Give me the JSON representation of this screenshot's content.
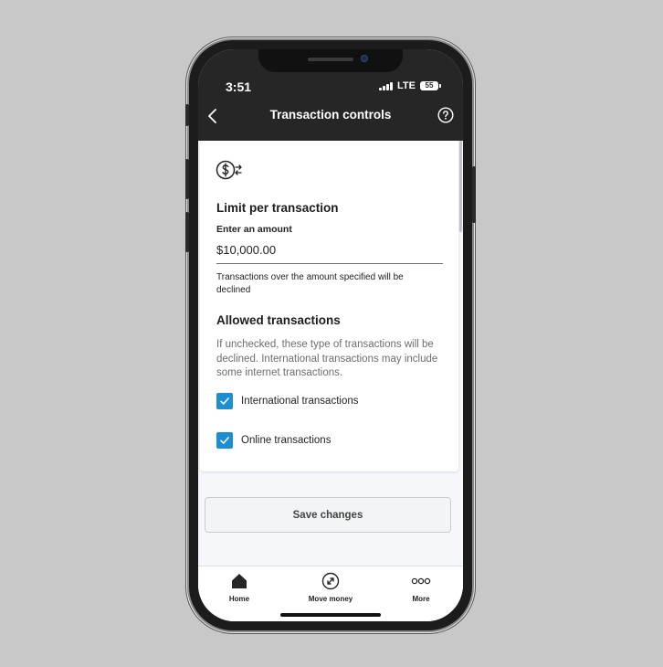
{
  "status_bar": {
    "time": "3:51",
    "network": "LTE",
    "battery": "55"
  },
  "header": {
    "title": "Transaction controls"
  },
  "limit": {
    "heading": "Limit per transaction",
    "input_label": "Enter an amount",
    "value": "$10,000.00",
    "helper": "Transactions over the amount specified will be declined"
  },
  "allowed": {
    "heading": "Allowed transactions",
    "description": "If unchecked, these type of transactions will be declined. International transactions may include some internet transactions.",
    "options": [
      {
        "label": "International transactions",
        "checked": true
      },
      {
        "label": "Online transactions",
        "checked": true
      }
    ]
  },
  "actions": {
    "save_label": "Save changes"
  },
  "tabbar": {
    "items": [
      {
        "label": "Home",
        "icon": "home-icon"
      },
      {
        "label": "Move money",
        "icon": "transfer-icon"
      },
      {
        "label": "More",
        "icon": "more-icon"
      }
    ]
  },
  "colors": {
    "accent": "#1a8fd3",
    "header_bg": "#262626",
    "page_bg": "#f5f7fb"
  }
}
